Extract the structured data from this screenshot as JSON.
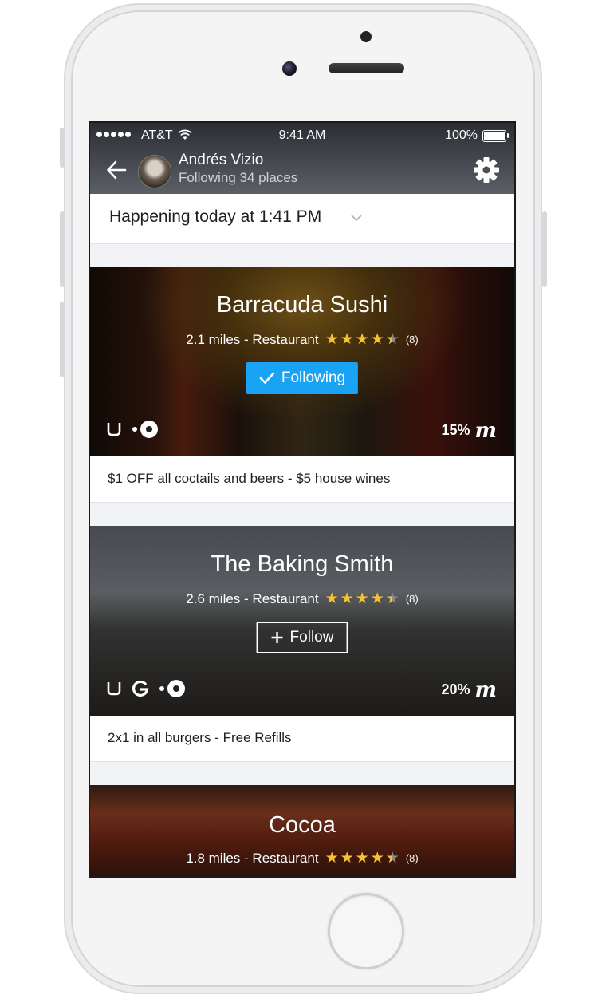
{
  "status_bar": {
    "carrier": "AT&T",
    "time": "9:41 AM",
    "battery": "100%"
  },
  "header": {
    "user_name": "Andrés Vizio",
    "subtitle": "Following 34 places"
  },
  "filter": {
    "label": "Happening today at 1:41 PM"
  },
  "places": [
    {
      "name": "Barracuda Sushi",
      "meta": "2.1 miles - Restaurant",
      "rating": 4.5,
      "rating_count": "(8)",
      "follow_label": "Following",
      "discount": "15%",
      "deal": "$1 OFF all coctails and beers - $5 house wines",
      "services": [
        "uber-icon",
        "ride-dot-icon"
      ]
    },
    {
      "name": "The Baking Smith",
      "meta": "2.6 miles - Restaurant",
      "rating": 4.5,
      "rating_count": "(8)",
      "follow_label": "Follow",
      "discount": "20%",
      "deal": "2x1 in all burgers - Free Refills",
      "services": [
        "uber-icon",
        "google-icon",
        "ride-dot-icon"
      ]
    },
    {
      "name": "Cocoa",
      "meta": "1.8 miles - Restaurant",
      "rating": 4.5,
      "rating_count": "(8)"
    }
  ],
  "colors": {
    "accent": "#1aa3f5",
    "star": "#f6c22d",
    "header_top": "#2b2e33"
  }
}
